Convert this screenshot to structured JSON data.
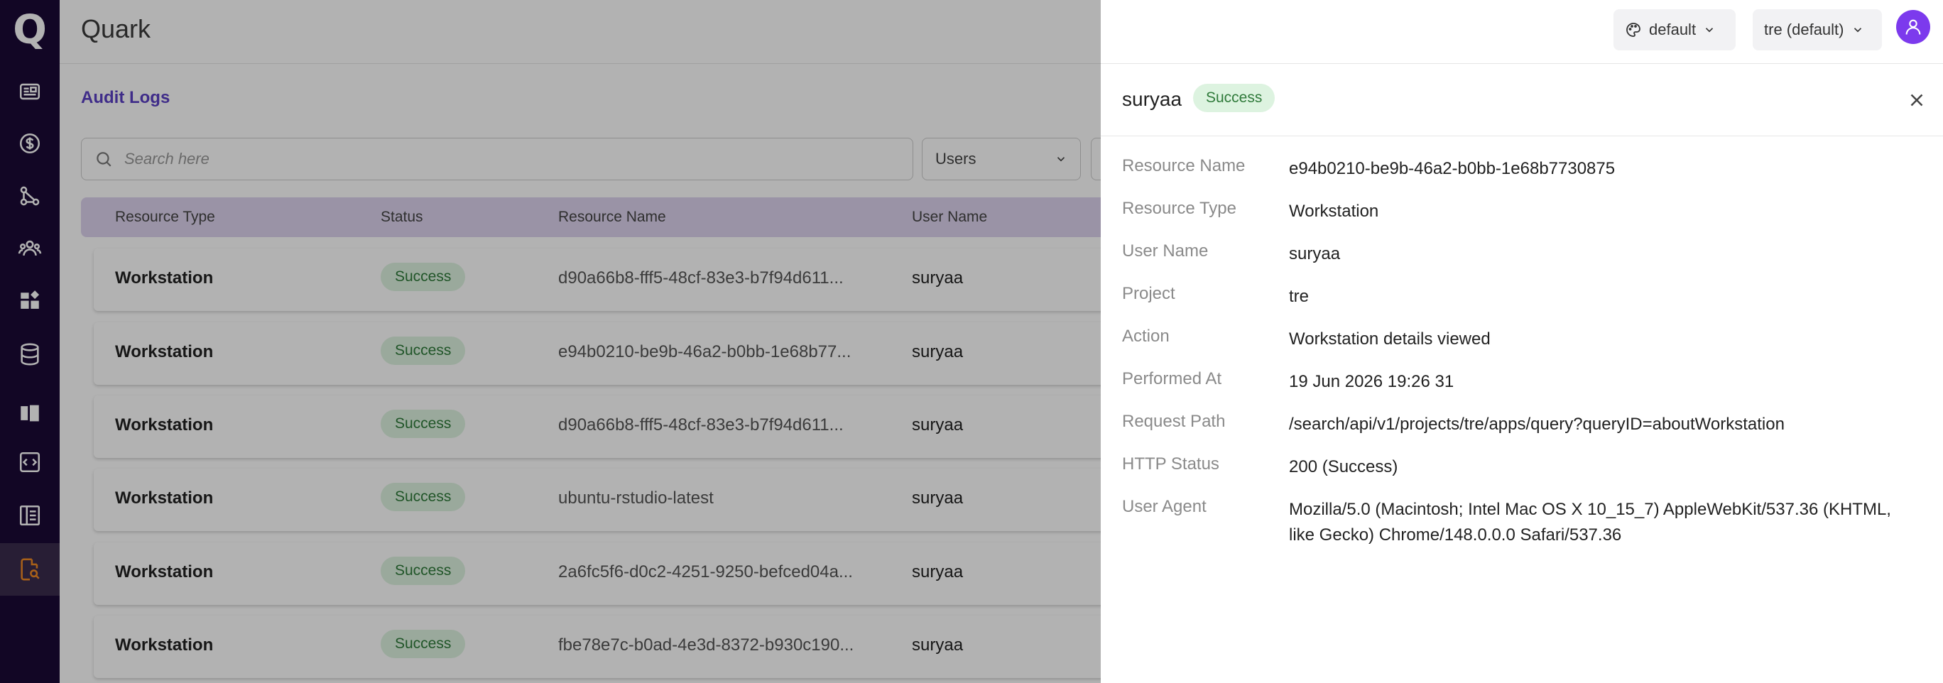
{
  "app": {
    "title": "Quark",
    "logo": "Q"
  },
  "sidebar": {
    "items": [
      {
        "icon": "id-card-icon"
      },
      {
        "icon": "dollar-icon"
      },
      {
        "icon": "workflow-icon"
      },
      {
        "icon": "users-icon"
      },
      {
        "icon": "widgets-icon"
      },
      {
        "icon": "database-icon"
      },
      {
        "icon": "notebook-icon"
      },
      {
        "icon": "code-icon"
      },
      {
        "icon": "spreadsheet-icon"
      },
      {
        "icon": "audit-log-icon",
        "active": true
      }
    ]
  },
  "header": {
    "theme_label": "default",
    "project_label": "tre (default)"
  },
  "main": {
    "breadcrumb": "Audit Logs",
    "search_placeholder": "Search here",
    "filter_users": "Users",
    "columns": [
      "Resource Type",
      "Status",
      "Resource Name",
      "User Name"
    ],
    "rows": [
      {
        "type": "Workstation",
        "status": "Success",
        "name": "d90a66b8-fff5-48cf-83e3-b7f94d611...",
        "user": "suryaa"
      },
      {
        "type": "Workstation",
        "status": "Success",
        "name": "e94b0210-be9b-46a2-b0bb-1e68b77...",
        "user": "suryaa"
      },
      {
        "type": "Workstation",
        "status": "Success",
        "name": "d90a66b8-fff5-48cf-83e3-b7f94d611...",
        "user": "suryaa"
      },
      {
        "type": "Workstation",
        "status": "Success",
        "name": "ubuntu-rstudio-latest",
        "user": "suryaa"
      },
      {
        "type": "Workstation",
        "status": "Success",
        "name": "2a6fc5f6-d0c2-4251-9250-befced04a...",
        "user": "suryaa"
      },
      {
        "type": "Workstation",
        "status": "Success",
        "name": "fbe78e7c-b0ad-4e3d-8372-b930c190...",
        "user": "suryaa"
      }
    ]
  },
  "drawer": {
    "user": "suryaa",
    "status": "Success",
    "details": [
      {
        "label": "Resource Name",
        "value": "e94b0210-be9b-46a2-b0bb-1e68b7730875"
      },
      {
        "label": "Resource Type",
        "value": "Workstation"
      },
      {
        "label": "User Name",
        "value": "suryaa"
      },
      {
        "label": "Project",
        "value": "tre"
      },
      {
        "label": "Action",
        "value": "Workstation details viewed"
      },
      {
        "label": "Performed At",
        "value": "19 Jun 2026 19:26 31"
      },
      {
        "label": "Request Path",
        "value": "/search/api/v1/projects/tre/apps/query?queryID=aboutWorkstation"
      },
      {
        "label": "HTTP Status",
        "value": "200 (Success)"
      },
      {
        "label": "User Agent",
        "value": "Mozilla/5.0 (Macintosh; Intel Mac OS X 10_15_7) AppleWebKit/537.36 (KHTML, like Gecko) Chrome/148.0.0.0 Safari/537.36"
      }
    ]
  },
  "colors": {
    "sidebar_bg": "#1b0a35",
    "accent": "#7c3aed",
    "success_bg": "#ddf3e0",
    "success_text": "#2f7a3a",
    "table_header_bg": "#ddd3ee"
  }
}
